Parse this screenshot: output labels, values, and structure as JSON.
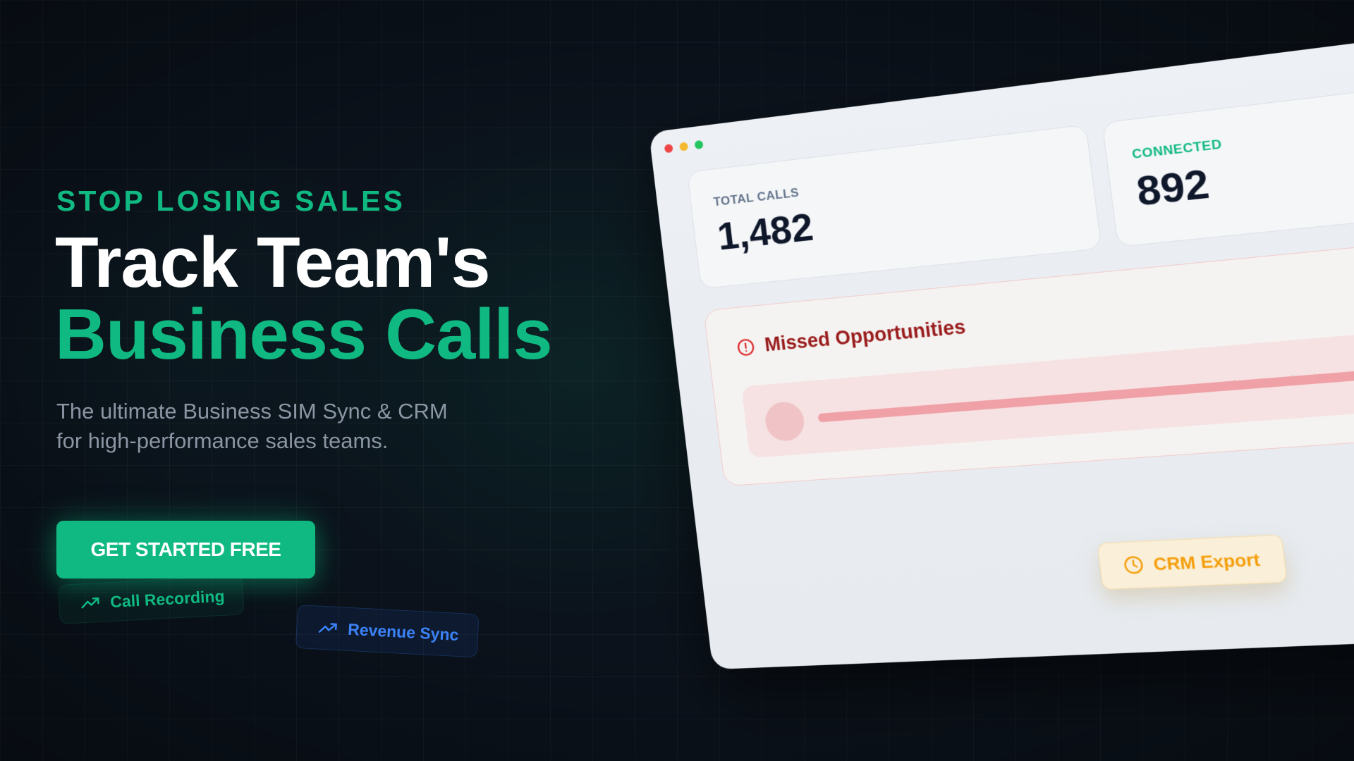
{
  "hero": {
    "eyebrow": "STOP LOSING SALES",
    "headline_line1": "Track Team's",
    "headline_line2": "Business Calls",
    "subtitle_line1": "The ultimate Business SIM Sync & CRM",
    "subtitle_line2": "for high-performance sales teams.",
    "cta_label": "GET STARTED FREE"
  },
  "chips": {
    "call_recording": {
      "label": "Call Recording",
      "icon": "trending-up-icon"
    },
    "revenue_sync": {
      "label": "Revenue Sync",
      "icon": "trending-up-icon"
    }
  },
  "mockup": {
    "total_calls": {
      "label": "TOTAL CALLS",
      "value": "1,482"
    },
    "connected": {
      "label": "CONNECTED",
      "value": "892"
    },
    "missed": {
      "title": "Missed Opportunities",
      "icon": "alert-circle-icon"
    },
    "crm_export": {
      "label": "CRM Export",
      "icon": "clock-icon"
    }
  },
  "colors": {
    "accent": "#10b981",
    "background": "#0b121b",
    "blue": "#3b82f6",
    "danger": "#991b1b",
    "warning": "#f59e0b"
  }
}
